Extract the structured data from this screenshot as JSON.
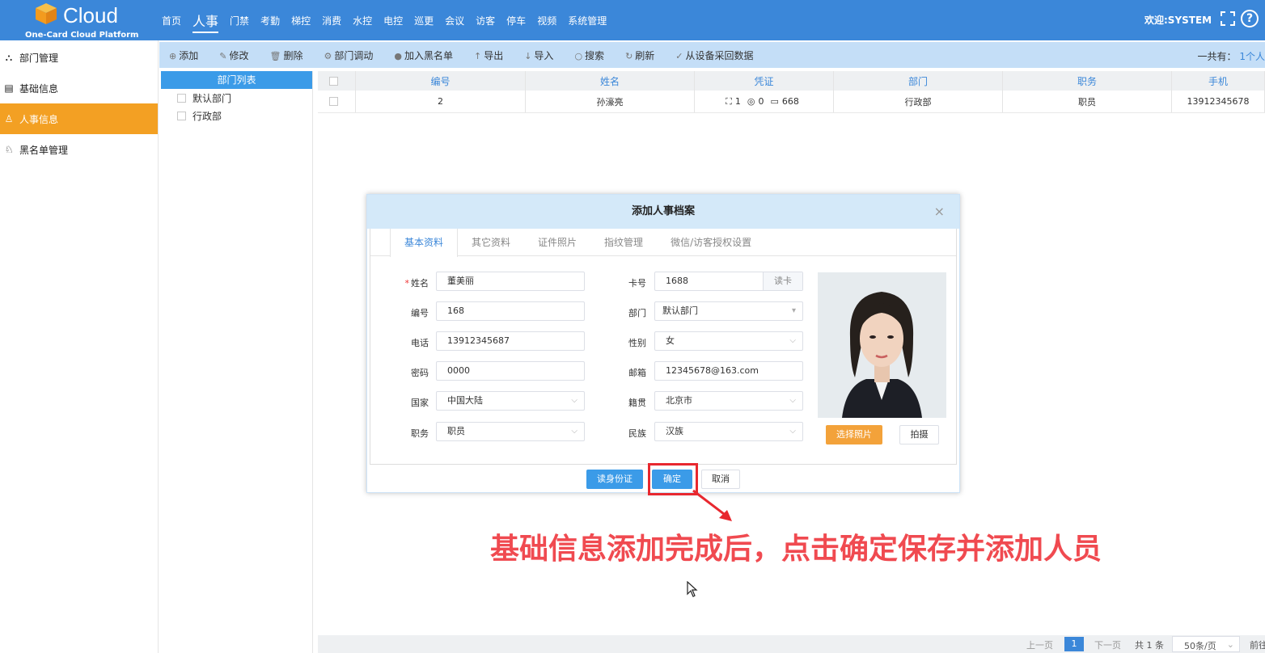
{
  "brand": {
    "name": "Cloud",
    "subtitle": "One-Card Cloud Platform"
  },
  "nav": [
    "首页",
    "人事",
    "门禁",
    "考勤",
    "梯控",
    "消费",
    "水控",
    "电控",
    "巡更",
    "会议",
    "访客",
    "停车",
    "视频",
    "系统管理"
  ],
  "nav_active": "人事",
  "welcome": "欢迎:SYSTEM",
  "help_glyph": "?",
  "sidebar": [
    {
      "label": "部门管理",
      "icon": "org-icon",
      "glyph": "⛬"
    },
    {
      "label": "基础信息",
      "icon": "list-icon",
      "glyph": "▤"
    },
    {
      "label": "人事信息",
      "icon": "person-icon",
      "glyph": "♙"
    },
    {
      "label": "黑名单管理",
      "icon": "blacklist-icon",
      "glyph": "♘"
    }
  ],
  "toolbar": [
    {
      "label": "添加",
      "icon": "⊕"
    },
    {
      "label": "修改",
      "icon": "✎"
    },
    {
      "label": "删除",
      "icon": "🗑"
    },
    {
      "label": "部门调动",
      "icon": "⚙"
    },
    {
      "label": "加入黑名单",
      "icon": "●"
    },
    {
      "label": "导出",
      "icon": "↑"
    },
    {
      "label": "导入",
      "icon": "↓"
    },
    {
      "label": "搜索",
      "icon": "○"
    },
    {
      "label": "刷新",
      "icon": "↻"
    },
    {
      "label": "从设备采回数据",
      "icon": "✓"
    }
  ],
  "total": {
    "prefix": "一共有：",
    "count": "1个人"
  },
  "dept": {
    "title": "部门列表",
    "items": [
      "默认部门",
      "行政部"
    ]
  },
  "table": {
    "headers": [
      "编号",
      "姓名",
      "凭证",
      "部门",
      "职务",
      "手机"
    ],
    "rows": [
      {
        "id": "2",
        "name": "孙濠亮",
        "cred_face": "1",
        "cred_finger": "0",
        "cred_card": "668",
        "dept": "行政部",
        "title": "职员",
        "phone": "13912345678"
      }
    ]
  },
  "pager": {
    "prev": "上一页",
    "current": "1",
    "next": "下一页",
    "total_pages": "共 1 条",
    "page_size": "50条/页",
    "goto": "前往"
  },
  "modal": {
    "title": "添加人事档案",
    "close": "×",
    "tabs": [
      "基本资料",
      "其它资料",
      "证件照片",
      "指纹管理",
      "微信/访客授权设置"
    ],
    "fields": {
      "name": {
        "label": "姓名",
        "value": "董美丽",
        "required": "*"
      },
      "number": {
        "label": "编号",
        "value": "168"
      },
      "phone": {
        "label": "电话",
        "value": "13912345687"
      },
      "password": {
        "label": "密码",
        "value": "0000"
      },
      "country": {
        "label": "国家",
        "value": "中国大陆"
      },
      "position": {
        "label": "职务",
        "value": "职员"
      },
      "card": {
        "label": "卡号",
        "value": "1688",
        "btn": "读卡"
      },
      "department": {
        "label": "部门",
        "value": "默认部门"
      },
      "gender": {
        "label": "性别",
        "value": "女"
      },
      "email": {
        "label": "邮箱",
        "value": "12345678@163.com"
      },
      "origin": {
        "label": "籍贯",
        "value": "北京市"
      },
      "ethnicity": {
        "label": "民族",
        "value": "汉族"
      }
    },
    "photo_select": "选择照片",
    "photo_capture": "拍摄",
    "footer": {
      "read_id": "读身份证",
      "confirm": "确定",
      "cancel": "取消"
    }
  },
  "annotation": "基础信息添加完成后，点击确定保存并添加人员",
  "colors": {
    "topbar": "#3b87d9",
    "active_side": "#f3a023",
    "highlight": "#e8282f",
    "caption": "#f04a50"
  }
}
